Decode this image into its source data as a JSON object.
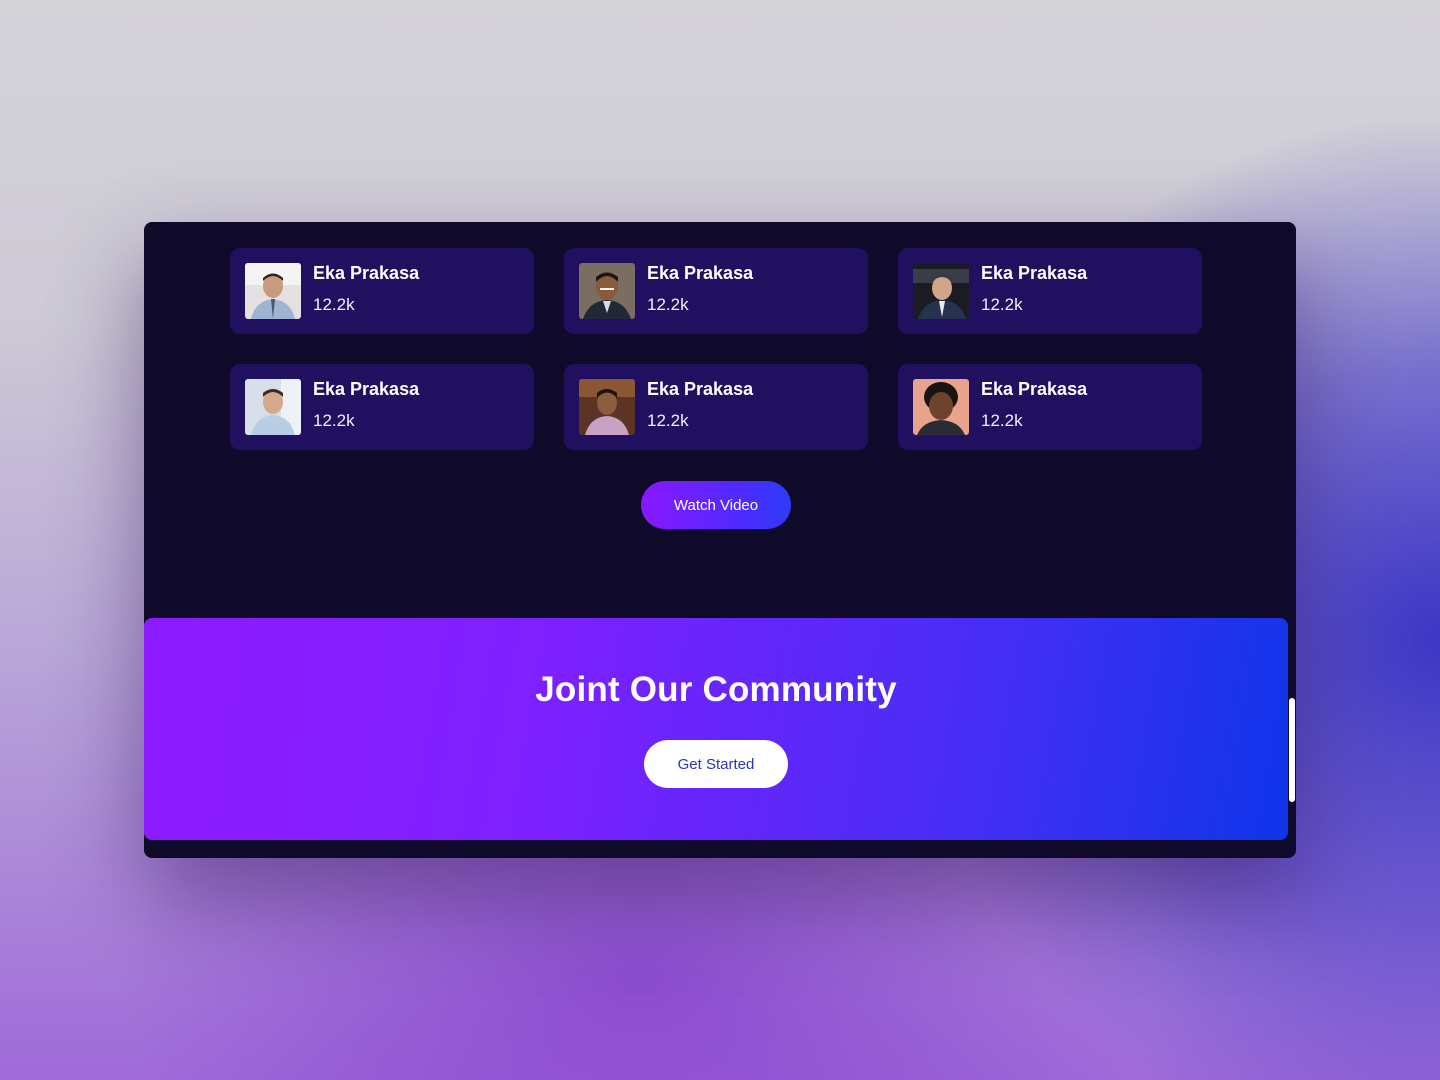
{
  "people": [
    {
      "name": "Eka Prakasa",
      "count": "12.2k",
      "avatar": "avatar-photo-1",
      "tone": "#d8d2cc"
    },
    {
      "name": "Eka Prakasa",
      "count": "12.2k",
      "avatar": "avatar-photo-2",
      "tone": "#6b5a4c"
    },
    {
      "name": "Eka Prakasa",
      "count": "12.2k",
      "avatar": "avatar-photo-3",
      "tone": "#2a2a34"
    },
    {
      "name": "Eka Prakasa",
      "count": "12.2k",
      "avatar": "avatar-photo-4",
      "tone": "#c9d4e2"
    },
    {
      "name": "Eka Prakasa",
      "count": "12.2k",
      "avatar": "avatar-photo-5",
      "tone": "#8a5a3a"
    },
    {
      "name": "Eka Prakasa",
      "count": "12.2k",
      "avatar": "avatar-photo-6",
      "tone": "#e59a80"
    }
  ],
  "watch_button": "Watch Video",
  "community": {
    "title": "Joint Our Community",
    "button": "Get Started"
  }
}
